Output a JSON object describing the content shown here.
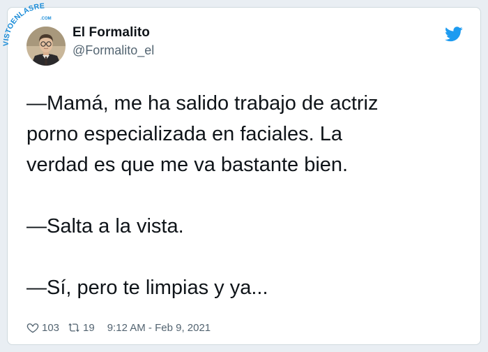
{
  "watermark": {
    "text": "VISTOENLASREDES",
    "subtext": ".COM"
  },
  "user": {
    "display_name": "El Formalito",
    "handle": "@Formalito_el"
  },
  "tweet": {
    "paragraphs": [
      "—Mamá, me ha salido trabajo de actriz",
      "porno especializada en faciales. La",
      "verdad es que me va bastante bien.",
      "—Salta a la vista.",
      "—Sí, pero te limpias y ya..."
    ]
  },
  "stats": {
    "likes": "103",
    "retweets": "19",
    "timestamp": "9:12 AM - Feb 9, 2021"
  },
  "icons": {
    "brand": "twitter-bird-icon",
    "like": "heart-icon",
    "retweet": "retweet-icon"
  },
  "colors": {
    "brand_blue": "#1d9bf0",
    "watermark_blue": "#1a8cd8",
    "text": "#0f1419",
    "secondary": "#536471"
  }
}
